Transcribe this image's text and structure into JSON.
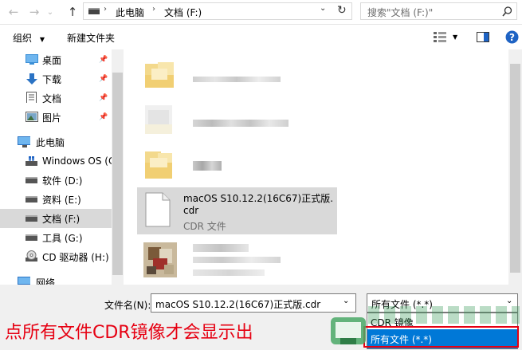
{
  "address_bar": {
    "path": [
      "此电脑",
      "文档 (F:)"
    ],
    "search_placeholder": "搜索\"文档 (F:)\""
  },
  "toolbar": {
    "organize_label": "组织",
    "new_folder_label": "新建文件夹"
  },
  "nav": {
    "items": [
      {
        "label": "桌面",
        "icon": "desktop-icon",
        "pinned": true
      },
      {
        "label": "下载",
        "icon": "download-icon",
        "pinned": true
      },
      {
        "label": "文档",
        "icon": "document-icon",
        "pinned": true
      },
      {
        "label": "图片",
        "icon": "picture-icon",
        "pinned": true
      },
      {
        "label": "此电脑",
        "icon": "computer-icon",
        "pinned": false
      },
      {
        "label": "Windows OS (C",
        "icon": "drive-windows-icon",
        "pinned": false
      },
      {
        "label": "软件 (D:)",
        "icon": "drive-icon",
        "pinned": false
      },
      {
        "label": "资料 (E:)",
        "icon": "drive-icon",
        "pinned": false
      },
      {
        "label": "文档 (F:)",
        "icon": "drive-icon",
        "pinned": false,
        "selected": true
      },
      {
        "label": "工具 (G:)",
        "icon": "drive-icon",
        "pinned": false
      },
      {
        "label": "CD 驱动器 (H:)",
        "icon": "cd-drive-icon",
        "pinned": false
      },
      {
        "label": "网络",
        "icon": "network-icon",
        "pinned": false
      }
    ]
  },
  "files": {
    "items": [
      {
        "name": "",
        "type": "",
        "icon": "folder-icon",
        "blurred": true
      },
      {
        "name": "",
        "type": "",
        "icon": "folder-icon",
        "blurred": true
      },
      {
        "name": "",
        "type": "",
        "icon": "folder-icon",
        "blurred": true
      },
      {
        "name_line1": "macOS S10.12.2(16C67)正式版.",
        "name_line2": "cdr",
        "type": "CDR 文件",
        "icon": "file-icon",
        "selected": true
      },
      {
        "name": "",
        "type": "",
        "icon": "image-file-icon",
        "blurred": true
      }
    ]
  },
  "bottom": {
    "filename_label": "文件名(N):",
    "filename_value": "macOS S10.12.2(16C67)正式版.cdr",
    "filetype_value": "所有文件 (*.*)",
    "dropdown_options": [
      "CDR 镜像",
      "所有文件 (*.*)"
    ],
    "annotation": "点所有文件CDR镜像才会显示出"
  },
  "colors": {
    "selection": "#cce8ff",
    "selection_gray": "#d9d9d9",
    "highlight_blue": "#0078d7",
    "annotation_red": "#e60012",
    "help_blue": "#1e63c4"
  }
}
